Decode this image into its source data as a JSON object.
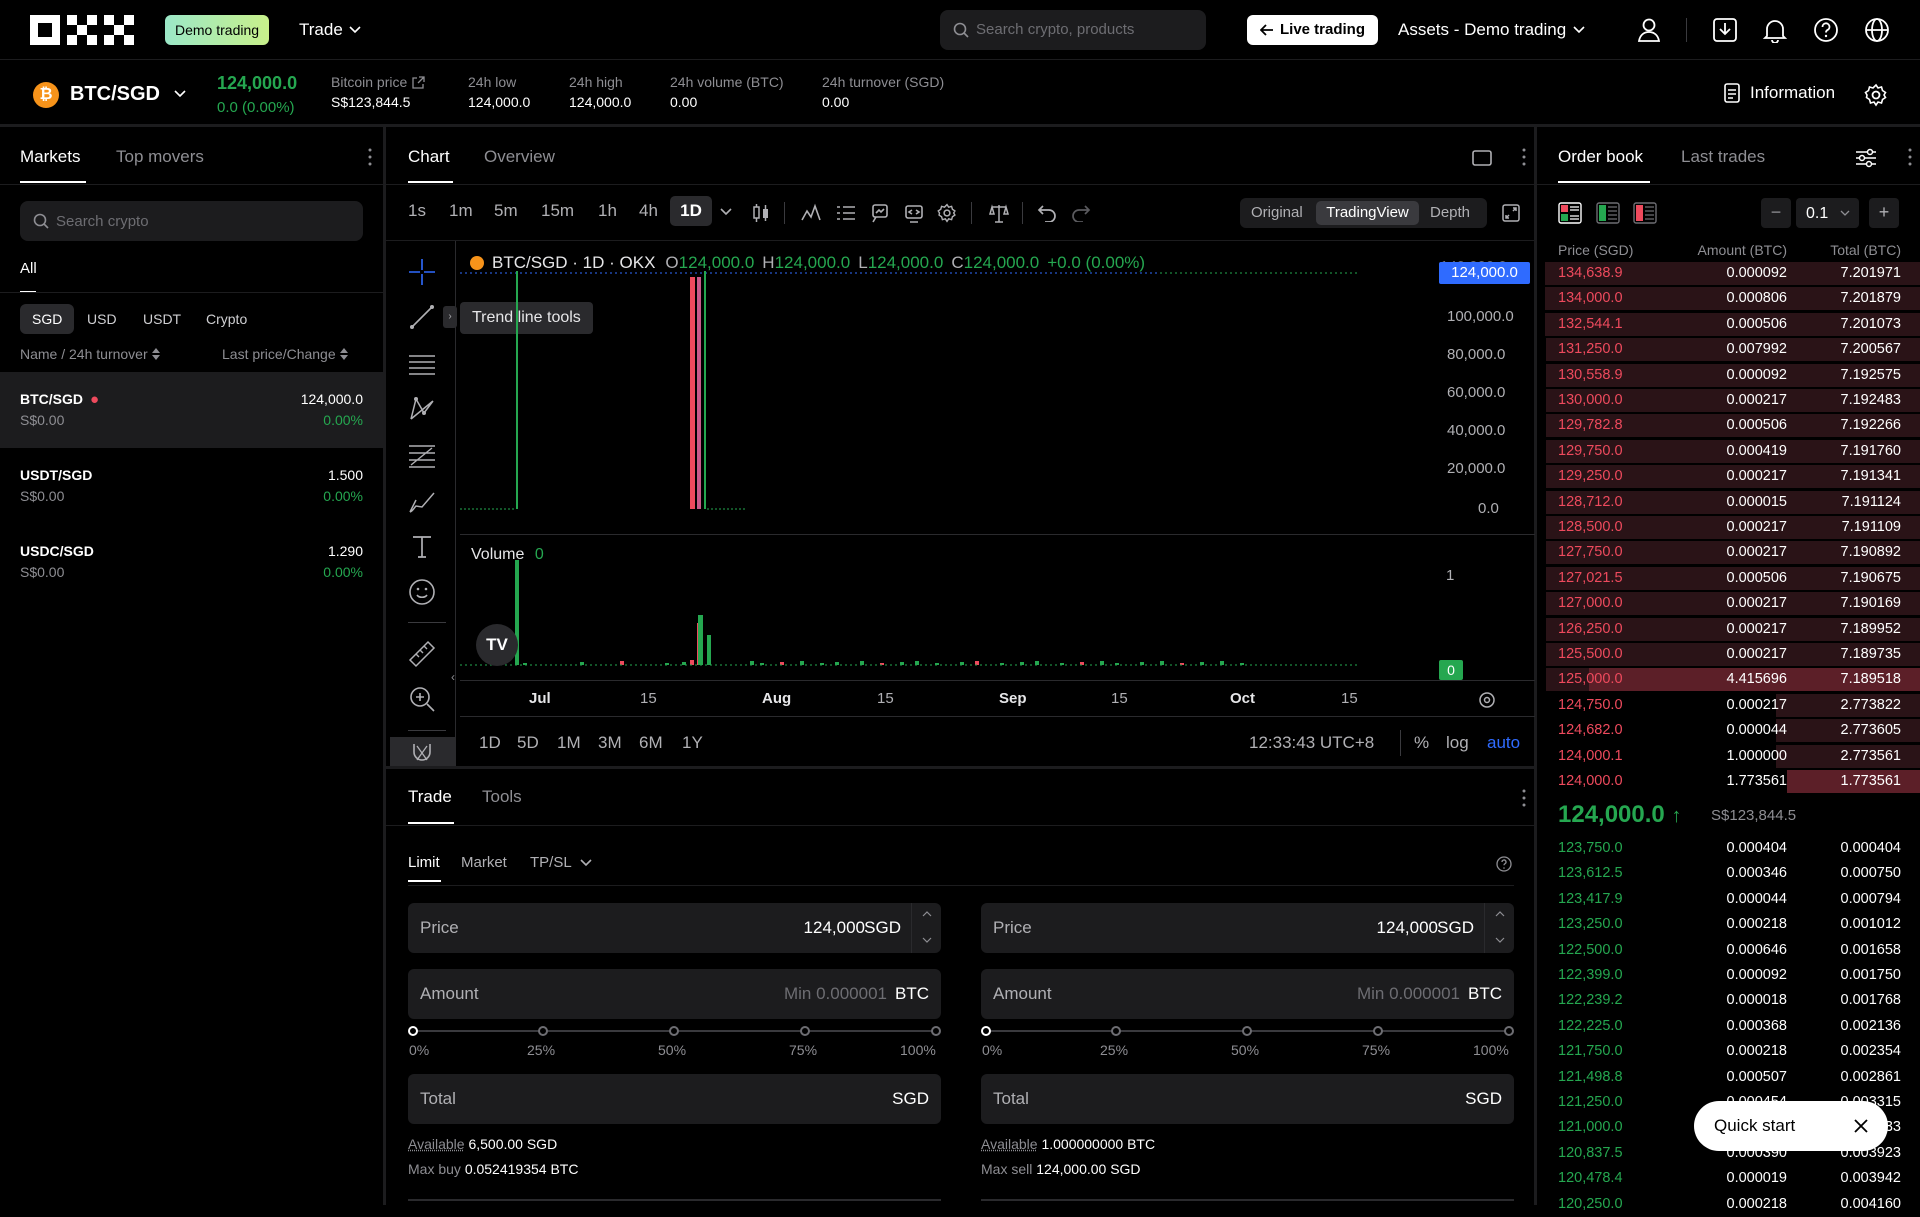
{
  "header": {
    "demo_badge": "Demo trading",
    "trade_menu": "Trade",
    "search_placeholder": "Search crypto, products",
    "live_trading": "Live trading",
    "assets_menu": "Assets - Demo trading"
  },
  "ticker": {
    "pair": "BTC/SGD",
    "last_price": "124,000.0",
    "change": "0.0 (0.00%)",
    "stats": [
      {
        "label": "Bitcoin price",
        "value": "S$123,844.5"
      },
      {
        "label": "24h low",
        "value": "124,000.0"
      },
      {
        "label": "24h high",
        "value": "124,000.0"
      },
      {
        "label": "24h volume (BTC)",
        "value": "0.00"
      },
      {
        "label": "24h turnover (SGD)",
        "value": "0.00"
      }
    ],
    "information": "Information"
  },
  "markets": {
    "tabs": [
      "Markets",
      "Top movers"
    ],
    "search_placeholder": "Search crypto",
    "filter_all": "All",
    "quote_tabs": [
      "SGD",
      "USD",
      "USDT",
      "Crypto"
    ],
    "col_left": "Name / 24h turnover",
    "col_right": "Last price/Change",
    "rows": [
      {
        "name": "BTC/SGD",
        "turnover": "S$0.00",
        "price": "124,000.0",
        "change": "0.00%"
      },
      {
        "name": "USDT/SGD",
        "turnover": "S$0.00",
        "price": "1.500",
        "change": "0.00%"
      },
      {
        "name": "USDC/SGD",
        "turnover": "S$0.00",
        "price": "1.290",
        "change": "0.00%"
      }
    ]
  },
  "chart": {
    "tabs": [
      "Chart",
      "Overview"
    ],
    "timeframes": [
      "1s",
      "1m",
      "5m",
      "15m",
      "1h",
      "4h",
      "1D"
    ],
    "views": [
      "Original",
      "TradingView",
      "Depth"
    ],
    "legend": {
      "symbol": "BTC/SGD · 1D · OKX",
      "o": "124,000.0",
      "h": "124,000.0",
      "l": "124,000.0",
      "c": "124,000.0",
      "chg": "+0.0 (0.00%)"
    },
    "tooltip": "Trend line tools",
    "price_tag": "124,000.0",
    "y_ticks": [
      "100,000.0",
      "80,000.0",
      "60,000.0",
      "40,000.0",
      "20,000.0",
      "0.0"
    ],
    "volume_label": "Volume",
    "volume_value": "0",
    "vol_ticks": [
      "1"
    ],
    "vol_tag": "0",
    "x_ticks": [
      "Jul",
      "15",
      "Aug",
      "15",
      "Sep",
      "15",
      "Oct",
      "15"
    ],
    "ranges": [
      "1D",
      "5D",
      "1M",
      "3M",
      "6M",
      "1Y"
    ],
    "clock": "12:33:43 UTC+8",
    "percent": "%",
    "log": "log",
    "auto": "auto"
  },
  "trade": {
    "tabs": [
      "Trade",
      "Tools"
    ],
    "order_types": [
      "Limit",
      "Market",
      "TP/SL"
    ],
    "buy": {
      "price_label": "Price",
      "price": "124,000",
      "price_unit": "SGD",
      "amount_label": "Amount",
      "amount_placeholder": "Min 0.000001",
      "amount_unit": "BTC",
      "total_label": "Total",
      "total_unit": "SGD",
      "available_label": "Available",
      "available": "6,500.00 SGD",
      "max_label": "Max buy",
      "max": "0.052419354 BTC"
    },
    "sell": {
      "price_label": "Price",
      "price": "124,000",
      "price_unit": "SGD",
      "amount_label": "Amount",
      "amount_placeholder": "Min 0.000001",
      "amount_unit": "BTC",
      "total_label": "Total",
      "total_unit": "SGD",
      "available_label": "Available",
      "available": "1.000000000 BTC",
      "max_label": "Max sell",
      "max": "124,000.00 SGD"
    },
    "slider_marks": [
      "0%",
      "25%",
      "50%",
      "75%",
      "100%"
    ]
  },
  "orderbook": {
    "tabs": [
      "Order book",
      "Last trades"
    ],
    "precision": "0.1",
    "headers": [
      "Price (SGD)",
      "Amount (BTC)",
      "Total (BTC)"
    ],
    "asks": [
      [
        "134,638.9",
        "0.000092",
        "7.201971"
      ],
      [
        "134,000.0",
        "0.000806",
        "7.201879"
      ],
      [
        "132,544.1",
        "0.000506",
        "7.201073"
      ],
      [
        "131,250.0",
        "0.007992",
        "7.200567"
      ],
      [
        "130,558.9",
        "0.000092",
        "7.192575"
      ],
      [
        "130,000.0",
        "0.000217",
        "7.192483"
      ],
      [
        "129,782.8",
        "0.000506",
        "7.192266"
      ],
      [
        "129,750.0",
        "0.000419",
        "7.191760"
      ],
      [
        "129,250.0",
        "0.000217",
        "7.191341"
      ],
      [
        "128,712.0",
        "0.000015",
        "7.191124"
      ],
      [
        "128,500.0",
        "0.000217",
        "7.191109"
      ],
      [
        "127,750.0",
        "0.000217",
        "7.190892"
      ],
      [
        "127,021.5",
        "0.000506",
        "7.190675"
      ],
      [
        "127,000.0",
        "0.000217",
        "7.190169"
      ],
      [
        "126,250.0",
        "0.000217",
        "7.189952"
      ],
      [
        "125,500.0",
        "0.000217",
        "7.189735"
      ],
      [
        "125,000.0",
        "4.415696",
        "7.189518"
      ],
      [
        "124,750.0",
        "0.000217",
        "2.773822"
      ],
      [
        "124,682.0",
        "0.000044",
        "2.773605"
      ],
      [
        "124,000.1",
        "1.000000",
        "2.773561"
      ],
      [
        "124,000.0",
        "1.773561",
        "1.773561"
      ]
    ],
    "mid_price": "124,000.0",
    "mid_fiat": "S$123,844.5",
    "bids": [
      [
        "123,750.0",
        "0.000404",
        "0.000404"
      ],
      [
        "123,612.5",
        "0.000346",
        "0.000750"
      ],
      [
        "123,417.9",
        "0.000044",
        "0.000794"
      ],
      [
        "123,250.0",
        "0.000218",
        "0.001012"
      ],
      [
        "122,500.0",
        "0.000646",
        "0.001658"
      ],
      [
        "122,399.0",
        "0.000092",
        "0.001750"
      ],
      [
        "122,239.2",
        "0.000018",
        "0.001768"
      ],
      [
        "122,225.0",
        "0.000368",
        "0.002136"
      ],
      [
        "121,750.0",
        "0.000218",
        "0.002354"
      ],
      [
        "121,498.8",
        "0.000507",
        "0.002861"
      ],
      [
        "121,250.0",
        "0.000454",
        "0.003315"
      ],
      [
        "121,000.0",
        "0.000218",
        "0.003533"
      ],
      [
        "120,837.5",
        "0.000390",
        "0.003923"
      ],
      [
        "120,478.4",
        "0.000019",
        "0.003942"
      ],
      [
        "120,250.0",
        "0.000218",
        "0.004160"
      ]
    ],
    "quick_start": "Quick start"
  },
  "colors": {
    "green": "#25a750",
    "red": "#ee4a5d",
    "accent_blue": "#2f6bff",
    "panel": "#1c1c1e"
  }
}
